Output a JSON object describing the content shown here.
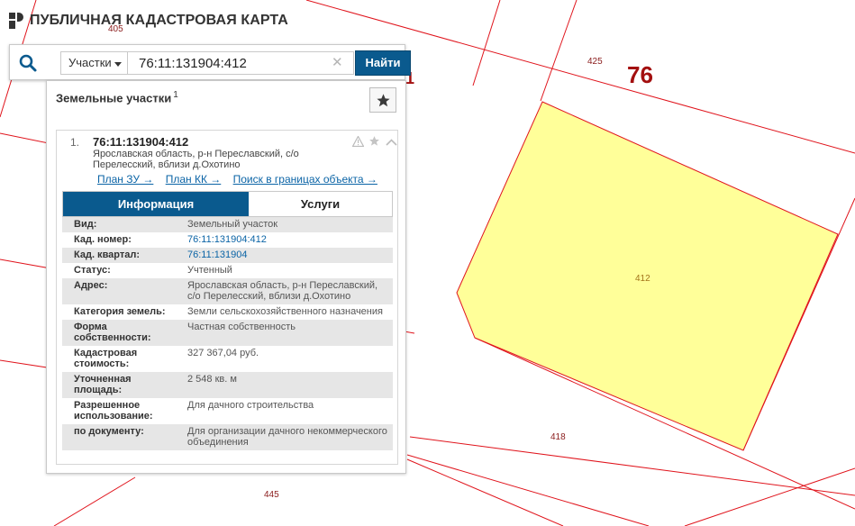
{
  "app": {
    "title": "ПУБЛИЧНАЯ КАДАСТРОВАЯ КАРТА"
  },
  "search": {
    "type_label": "Участки",
    "value": "76:11:131904:412",
    "find_label": "Найти"
  },
  "results": {
    "title": "Земельные участки",
    "count": "1",
    "item": {
      "index": "1.",
      "cad_number": "76:11:131904:412",
      "address": "Ярославская область, р-н Переславский, с/о Перелесский, вблизи д.Охотино",
      "links": [
        "План ЗУ →",
        "План КК →",
        "Поиск в границах объекта →"
      ]
    },
    "tabs": {
      "info": "Информация",
      "services": "Услуги"
    },
    "rows": [
      {
        "key": "Вид:",
        "value": "Земельный участок",
        "link": false
      },
      {
        "key": "Кад. номер:",
        "value": "76:11:131904:412",
        "link": true
      },
      {
        "key": "Кад. квартал:",
        "value": "76:11:131904",
        "link": true
      },
      {
        "key": "Статус:",
        "value": "Учтенный",
        "link": false
      },
      {
        "key": "Адрес:",
        "value": "Ярославская область, р-н Переславский, с/о Перелесский, вблизи д.Охотино",
        "link": false
      },
      {
        "key": "Категория земель:",
        "value": "Земли сельскохозяйственного назначения",
        "link": false
      },
      {
        "key": "Форма собственности:",
        "value": "Частная собственность",
        "link": false
      },
      {
        "key": "Кадастровая стоимость:",
        "value": "327 367,04 руб.",
        "link": false
      },
      {
        "key": "Уточненная площадь:",
        "value": "2 548 кв. м",
        "link": false
      },
      {
        "key": "Разрешенное использование:",
        "value": "Для дачного строительства",
        "link": false
      },
      {
        "key": "по документу:",
        "value": "Для организации дачного некоммерческого объединения",
        "link": false
      }
    ]
  },
  "map": {
    "region": "76",
    "parcel": "412",
    "labels": [
      "405",
      "425",
      "418",
      "445",
      "1"
    ]
  },
  "colors": {
    "accent": "#0a5a8e",
    "parcel_fill": "#ffff99",
    "boundary": "#e0141c"
  }
}
